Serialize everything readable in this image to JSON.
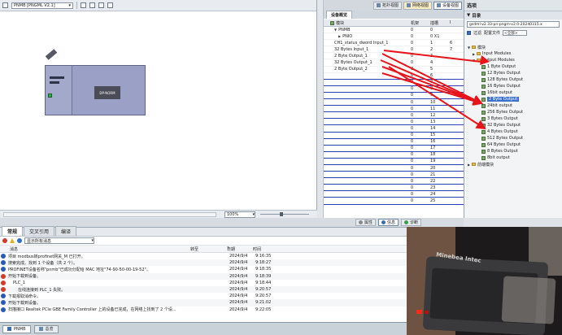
{
  "device_view": {
    "device_select": "PNMB [PNGML V2.1]",
    "module_label": "DP-NORM",
    "zoom": "100%"
  },
  "view_tabs": [
    "拓扑视图",
    "网络视图",
    "设备视图"
  ],
  "overview": {
    "tab_label": "设备概览",
    "columns": [
      "模块",
      "机架",
      "插槽",
      "I"
    ],
    "rows": [
      {
        "name": "PNMB",
        "rack": "0",
        "slot": "0",
        "ext": "",
        "indent": 1,
        "arrow": "▼"
      },
      {
        "name": "PNIO",
        "rack": "0",
        "slot": "0 X1",
        "ext": "",
        "indent": 2,
        "arrow": "▶"
      },
      {
        "name": "CH1_status_dword Input_1",
        "rack": "0",
        "slot": "1",
        "ext": "6",
        "indent": 1,
        "arrow": ""
      },
      {
        "name": "32 Bytes Input_1",
        "rack": "0",
        "slot": "2",
        "ext": "7",
        "indent": 1,
        "arrow": ""
      },
      {
        "name": "2 Byte Output_1",
        "rack": "0",
        "slot": "3",
        "ext": "",
        "indent": 1,
        "arrow": ""
      },
      {
        "name": "32 Bytes Output_1",
        "rack": "0",
        "slot": "4",
        "ext": "",
        "indent": 1,
        "arrow": ""
      },
      {
        "name": "2 Byte Output_2",
        "rack": "0",
        "slot": "5",
        "ext": "",
        "indent": 1,
        "arrow": ""
      },
      {
        "name": "",
        "rack": "0",
        "slot": "6",
        "ext": "",
        "indent": 0,
        "arrow": ""
      },
      {
        "name": "",
        "rack": "0",
        "slot": "7",
        "ext": "",
        "indent": 0,
        "arrow": ""
      },
      {
        "name": "",
        "rack": "0",
        "slot": "8",
        "ext": "",
        "indent": 0,
        "arrow": ""
      },
      {
        "name": "",
        "rack": "0",
        "slot": "9",
        "ext": "",
        "indent": 0,
        "arrow": ""
      },
      {
        "name": "",
        "rack": "0",
        "slot": "10",
        "ext": "",
        "indent": 0,
        "arrow": ""
      },
      {
        "name": "",
        "rack": "0",
        "slot": "11",
        "ext": "",
        "indent": 0,
        "arrow": ""
      },
      {
        "name": "",
        "rack": "0",
        "slot": "12",
        "ext": "",
        "indent": 0,
        "arrow": ""
      },
      {
        "name": "",
        "rack": "0",
        "slot": "13",
        "ext": "",
        "indent": 0,
        "arrow": ""
      },
      {
        "name": "",
        "rack": "0",
        "slot": "14",
        "ext": "",
        "indent": 0,
        "arrow": ""
      },
      {
        "name": "",
        "rack": "0",
        "slot": "15",
        "ext": "",
        "indent": 0,
        "arrow": ""
      },
      {
        "name": "",
        "rack": "0",
        "slot": "16",
        "ext": "",
        "indent": 0,
        "arrow": ""
      },
      {
        "name": "",
        "rack": "0",
        "slot": "17",
        "ext": "",
        "indent": 0,
        "arrow": ""
      },
      {
        "name": "",
        "rack": "0",
        "slot": "18",
        "ext": "",
        "indent": 0,
        "arrow": ""
      },
      {
        "name": "",
        "rack": "0",
        "slot": "19",
        "ext": "",
        "indent": 0,
        "arrow": ""
      },
      {
        "name": "",
        "rack": "0",
        "slot": "20",
        "ext": "",
        "indent": 0,
        "arrow": ""
      },
      {
        "name": "",
        "rack": "0",
        "slot": "21",
        "ext": "",
        "indent": 0,
        "arrow": ""
      },
      {
        "name": "",
        "rack": "0",
        "slot": "22",
        "ext": "",
        "indent": 0,
        "arrow": ""
      },
      {
        "name": "",
        "rack": "0",
        "slot": "23",
        "ext": "",
        "indent": 0,
        "arrow": ""
      },
      {
        "name": "",
        "rack": "0",
        "slot": "24",
        "ext": "",
        "indent": 0,
        "arrow": ""
      },
      {
        "name": "",
        "rack": "0",
        "slot": "25",
        "ext": "",
        "indent": 0,
        "arrow": ""
      }
    ]
  },
  "catalog": {
    "title": "选项",
    "directory": "目录",
    "search": "gsdml-v2.33-pn-pngm-v2.0-20240315.x",
    "filter_label": "过滤",
    "profile_label": "配置文件",
    "profile_value": "<全部>",
    "tree": [
      {
        "label": "模块",
        "indent": 0,
        "arrow": "▼",
        "icon": "folder"
      },
      {
        "label": "Input Modules",
        "indent": 1,
        "arrow": "▶",
        "icon": "folder"
      },
      {
        "label": "Output Modules",
        "indent": 1,
        "arrow": "▼",
        "icon": "folder"
      },
      {
        "label": "1 Byte Output",
        "indent": 2,
        "arrow": "",
        "icon": "module"
      },
      {
        "label": "12 Bytes Output",
        "indent": 2,
        "arrow": "",
        "icon": "module"
      },
      {
        "label": "128 Bytes Output",
        "indent": 2,
        "arrow": "",
        "icon": "module"
      },
      {
        "label": "16 Bytes Output",
        "indent": 2,
        "arrow": "",
        "icon": "module"
      },
      {
        "label": "16bit output",
        "indent": 2,
        "arrow": "",
        "icon": "module"
      },
      {
        "label": "2 Byte Output",
        "indent": 2,
        "arrow": "",
        "icon": "module",
        "selected": true
      },
      {
        "label": "24bit output",
        "indent": 2,
        "arrow": "",
        "icon": "module"
      },
      {
        "label": "256 Bytes Output",
        "indent": 2,
        "arrow": "",
        "icon": "module"
      },
      {
        "label": "3 Bytes Output",
        "indent": 2,
        "arrow": "",
        "icon": "module"
      },
      {
        "label": "32 Bytes Output",
        "indent": 2,
        "arrow": "",
        "icon": "module"
      },
      {
        "label": "4 Bytes Output",
        "indent": 2,
        "arrow": "",
        "icon": "module"
      },
      {
        "label": "512 Bytes Output",
        "indent": 2,
        "arrow": "",
        "icon": "module"
      },
      {
        "label": "64 Bytes Output",
        "indent": 2,
        "arrow": "",
        "icon": "module"
      },
      {
        "label": "8 Bytes Output",
        "indent": 2,
        "arrow": "",
        "icon": "module"
      },
      {
        "label": "8bit output",
        "indent": 2,
        "arrow": "",
        "icon": "module"
      },
      {
        "label": "前端模块",
        "indent": 0,
        "arrow": "▶",
        "icon": "folder"
      }
    ]
  },
  "info_strip": {
    "properties": "属性",
    "info": "信息",
    "diagnostics": "诊断"
  },
  "info_panel": {
    "tabs": [
      "常规",
      "交叉引用",
      "编译"
    ],
    "filter_value": "显示所有消息",
    "columns": {
      "message": "消息",
      "goto": "转至",
      "q": "?",
      "date": "日期",
      "time": "时间"
    },
    "messages": [
      {
        "text": "项目 modbus转profinet网关_M 已打开。",
        "date": "2024/9/4",
        "time": "9:16:35",
        "icon": "ok"
      },
      {
        "text": "搜索完成。找到 1 个设备（共 2 个）。",
        "date": "2024/9/4",
        "time": "9:18:27",
        "icon": "ok"
      },
      {
        "text": "PROFINET设备名称\"pnmb\"已成功分配给 MAC 地址\"74-90-50-00-19-52\"。",
        "date": "2024/9/4",
        "time": "9:18:35",
        "icon": "ok"
      },
      {
        "text": "开始下载到设备。",
        "date": "2024/9/4",
        "time": "9:18:39",
        "icon": "err"
      },
      {
        "text": "PLC_1",
        "date": "2024/9/4",
        "time": "9:18:44",
        "icon": "err",
        "indent": 1
      },
      {
        "text": "在线连接到 PLC_1 失败。",
        "date": "2024/9/4",
        "time": "9:20:57",
        "icon": "err",
        "indent": 2
      },
      {
        "text": "下载报取消命令。",
        "date": "2024/9/4",
        "time": "9:20:57",
        "icon": "ok"
      },
      {
        "text": "开始下载到设备。",
        "date": "2024/9/4",
        "time": "9:21:02",
        "icon": "ok"
      },
      {
        "text": "扫描接口 Realtek PCIe GBE Family Controller 上的设备已完成，在网络上找到了 2 个设...",
        "date": "2024/9/4",
        "time": "9:22:05",
        "icon": "ok"
      }
    ]
  },
  "taskbar": {
    "items": [
      "PNMB",
      "总览"
    ]
  },
  "camera": {
    "brand": "Minebea Intec"
  }
}
